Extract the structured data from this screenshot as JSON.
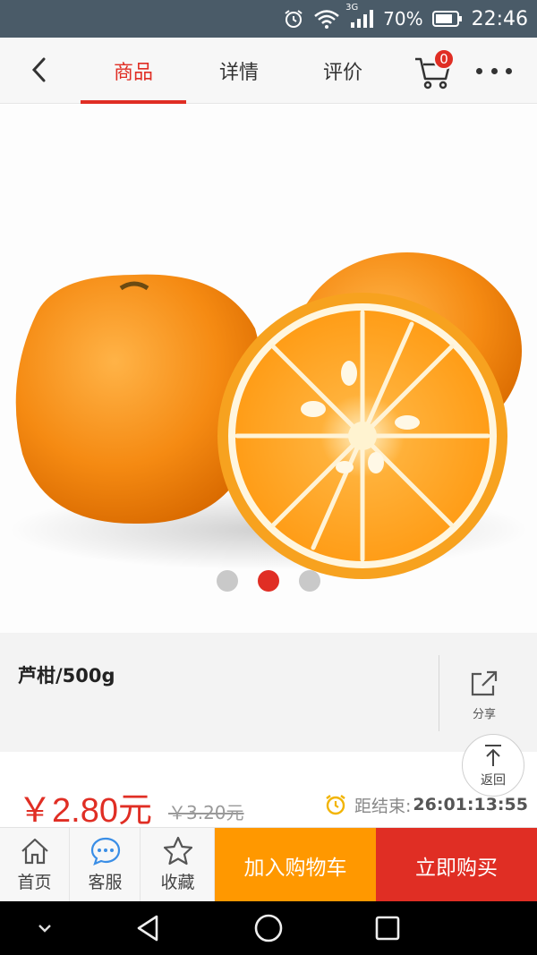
{
  "status_bar": {
    "network": "3G",
    "battery": "70%",
    "time": "22:46",
    "icons": [
      "alarm-icon",
      "wifi-icon",
      "signal-icon",
      "battery-icon"
    ]
  },
  "nav": {
    "tabs": [
      {
        "label": "商品",
        "active": true
      },
      {
        "label": "详情",
        "active": false
      },
      {
        "label": "评价",
        "active": false
      }
    ],
    "cart_badge": "0",
    "accent": "#e02e24"
  },
  "carousel": {
    "total": 3,
    "active_index": 1
  },
  "product": {
    "name": "芦柑/500g",
    "share_label": "分享"
  },
  "pricing": {
    "price": "￥2.80元",
    "original_price": "￥3.20元",
    "countdown_label": "距结束:",
    "countdown_value": "26:01:13:55",
    "back_to_top_label": "返回"
  },
  "actions": {
    "home": "首页",
    "service": "客服",
    "favorite": "收藏",
    "add_to_cart": "加入购物车",
    "buy_now": "立即购买",
    "add_to_cart_color": "#ff9800",
    "buy_now_color": "#e02e24"
  }
}
